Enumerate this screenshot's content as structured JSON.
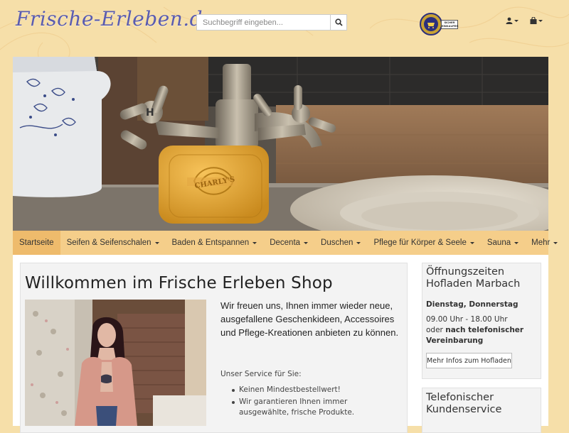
{
  "header": {
    "logo": "Frische-Erleben.de",
    "search_placeholder": "Suchbegriff eingeben...",
    "trust_badge_text": "SICHER EINKAUFEN",
    "user_icon": "user-icon",
    "cart_icon": "shopping-bag-icon"
  },
  "nav": {
    "items": [
      {
        "label": "Startseite",
        "dropdown": false,
        "active": true
      },
      {
        "label": "Seifen & Seifenschalen",
        "dropdown": true
      },
      {
        "label": "Baden & Entspannen",
        "dropdown": true
      },
      {
        "label": "Decenta",
        "dropdown": true
      },
      {
        "label": "Duschen",
        "dropdown": true
      },
      {
        "label": "Pflege für Körper & Seele",
        "dropdown": true
      },
      {
        "label": "Sauna",
        "dropdown": true
      },
      {
        "label": "Mehr",
        "dropdown": true
      }
    ]
  },
  "main": {
    "title": "Willkommen im Frische Erleben Shop",
    "intro": "Wir freuen uns, Ihnen immer wieder neue, ausgefallene Geschenkideen, Accessoires und Pflege-Kreationen anbieten zu können.",
    "service_title": "Unser Service für Sie:",
    "service_items": [
      "Keinen Mindestbestellwert!",
      "Wir garantieren Ihnen immer ausgewählte, frische Produkte."
    ]
  },
  "sidebar": {
    "hours_title_1": "Öffnungszeiten",
    "hours_title_2": "Hofladen Marbach",
    "days": "Dienstag, Donnerstag",
    "time": "09.00 Uhr - 18.00 Uhr",
    "or": "oder",
    "appointment": "nach telefonischer Vereinbarung",
    "button": "Mehr Infos zum Hofladen",
    "phone_title_1": "Telefonischer",
    "phone_title_2": "Kundenservice"
  },
  "colors": {
    "background": "#f6dfa9",
    "nav": "#f5ce8a",
    "nav_active": "#eebb6c",
    "logo": "#5a5cb0"
  }
}
